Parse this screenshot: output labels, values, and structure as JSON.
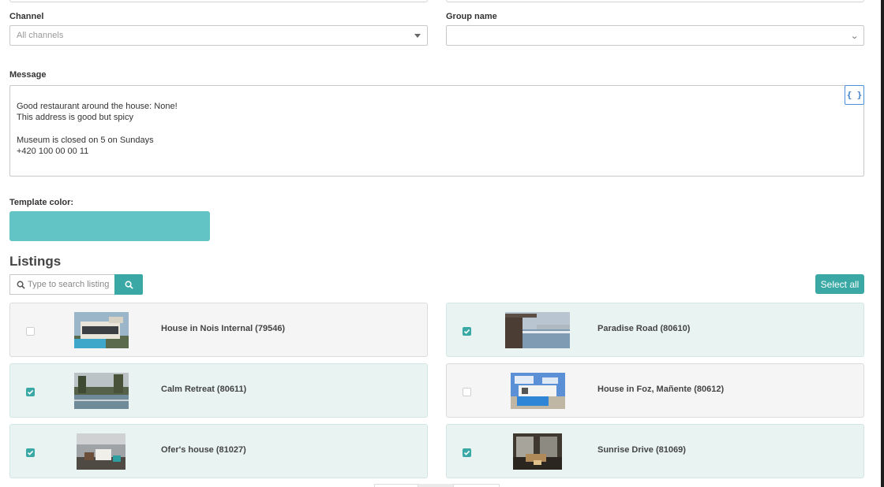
{
  "form": {
    "channel": {
      "label": "Channel",
      "placeholder": "All channels"
    },
    "group": {
      "label": "Group name",
      "value": ""
    },
    "message": {
      "label": "Message",
      "lines": [
        "Good restaurant around the house: None!",
        "This address is good but spicy",
        "",
        "Museum is closed on 5 on Sundays",
        "+420 100 00 00 11"
      ],
      "variables_button": "{ }"
    },
    "template_color": {
      "label": "Template color:",
      "color": "#62c4c4"
    }
  },
  "listings": {
    "title": "Listings",
    "search_placeholder": "Type to search listing",
    "search_icon": "search-icon",
    "select_all": "Select all",
    "accent_color": "#3aa9a5",
    "items": [
      {
        "name": "House in Nois Internal (79546)",
        "checked": false
      },
      {
        "name": "Paradise Road (80610)",
        "checked": true
      },
      {
        "name": "Calm Retreat (80611)",
        "checked": true
      },
      {
        "name": "House in Foz, Mañente (80612)",
        "checked": false
      },
      {
        "name": "Ofer's house (81027)",
        "checked": true
      },
      {
        "name": "Sunrise Drive (81069)",
        "checked": true
      }
    ]
  }
}
